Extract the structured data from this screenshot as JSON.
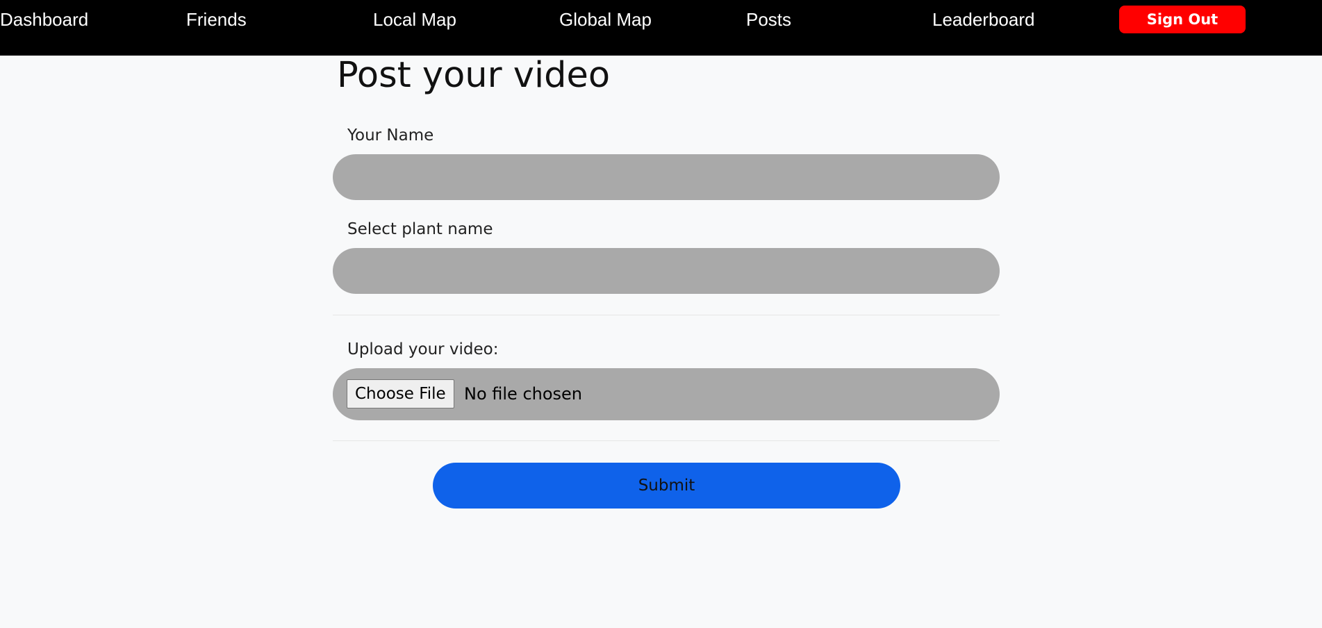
{
  "nav": {
    "items": [
      {
        "label": "Dashboard"
      },
      {
        "label": "Friends"
      },
      {
        "label": "Local Map"
      },
      {
        "label": "Global Map"
      },
      {
        "label": "Posts"
      },
      {
        "label": "Leaderboard"
      }
    ],
    "sign_out_label": "Sign Out"
  },
  "form": {
    "title": "Post your video",
    "name_label": "Your Name",
    "name_value": "",
    "plant_label": "Select plant name",
    "plant_value": "",
    "upload_label": "Upload your video:",
    "choose_file_label": "Choose File",
    "file_status": "No file chosen",
    "submit_label": "Submit"
  },
  "colors": {
    "nav_background": "#000000",
    "sign_out": "#ff0000",
    "input_background": "#a9a9a9",
    "submit": "#0f62ea",
    "page_background": "#f8f9fa"
  }
}
